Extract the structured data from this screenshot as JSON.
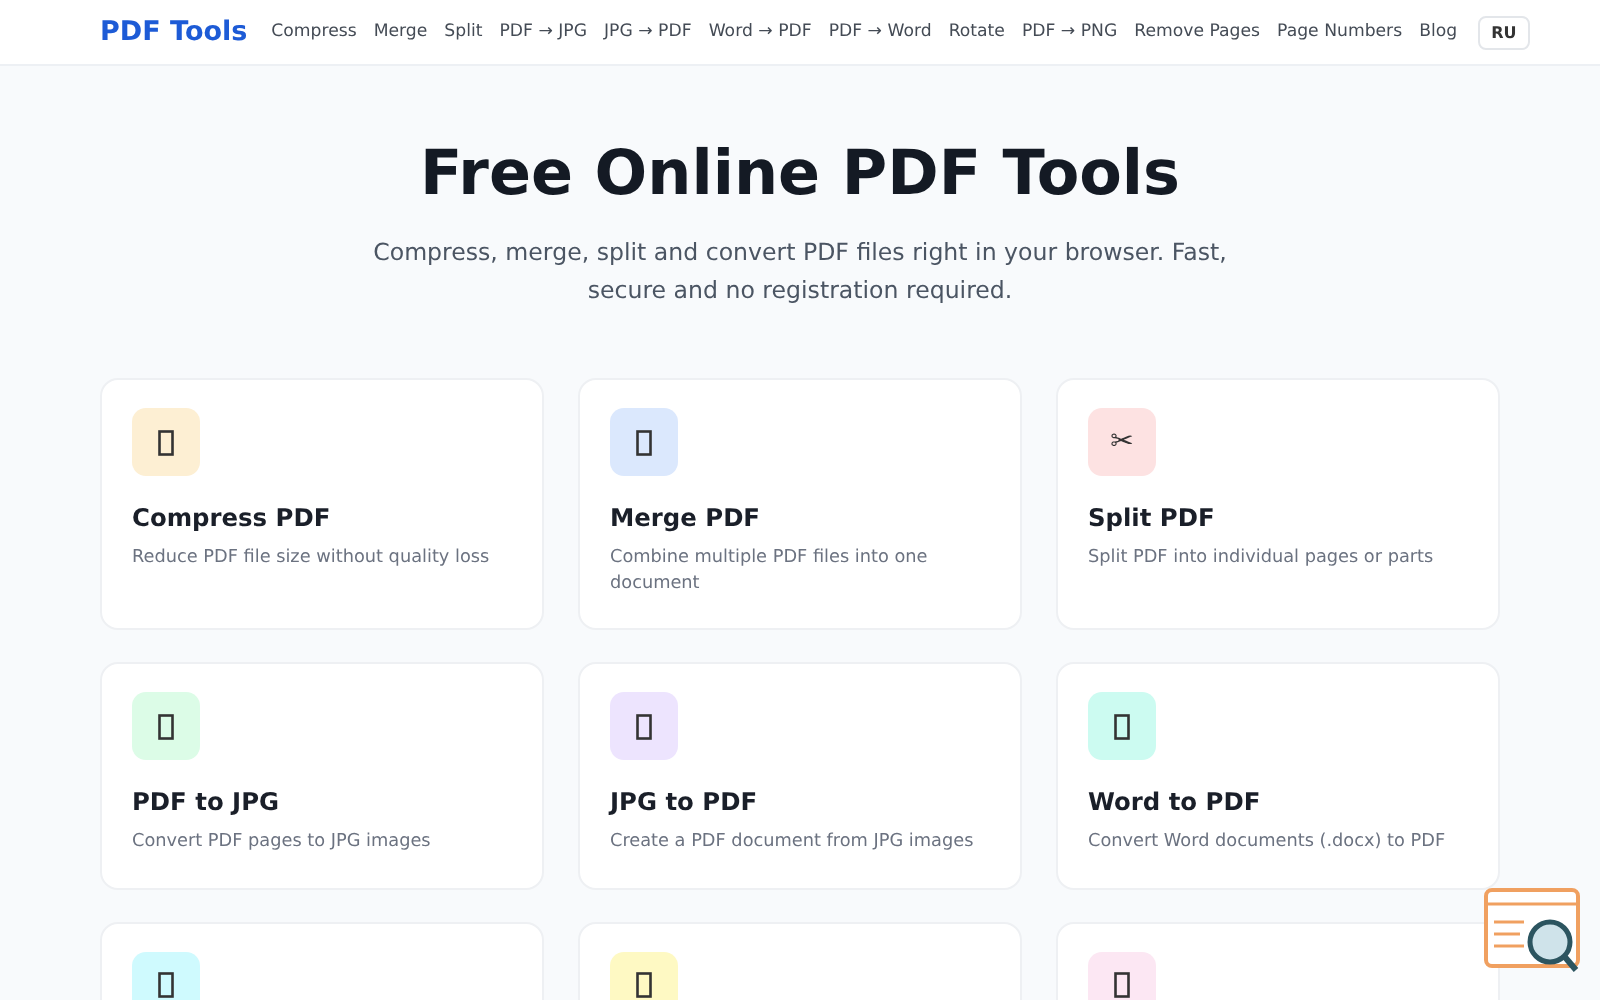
{
  "header": {
    "logo": "PDF Tools",
    "nav": [
      "Compress",
      "Merge",
      "Split",
      "PDF → JPG",
      "JPG → PDF",
      "Word → PDF",
      "PDF → Word",
      "Rotate",
      "PDF → PNG",
      "Remove Pages",
      "Page Numbers",
      "Blog"
    ],
    "language": "RU"
  },
  "hero": {
    "title": "Free Online PDF Tools",
    "subtitle": "Compress, merge, split and convert PDF files right in your browser. Fast, secure and no registration required."
  },
  "tools": [
    {
      "kind": "missing",
      "color": "#fdefd3",
      "title": "Compress PDF",
      "description": "Reduce PDF file size without quality loss"
    },
    {
      "kind": "missing",
      "color": "#dbe8fd",
      "title": "Merge PDF",
      "description": "Combine multiple PDF files into one document"
    },
    {
      "kind": "glyph",
      "glyph": "✂",
      "color": "#fde2e2",
      "title": "Split PDF",
      "description": "Split PDF into individual pages or parts"
    },
    {
      "kind": "missing",
      "color": "#dcfce7",
      "title": "PDF to JPG",
      "description": "Convert PDF pages to JPG images"
    },
    {
      "kind": "missing",
      "color": "#ede4fe",
      "title": "JPG to PDF",
      "description": "Create a PDF document from JPG images"
    },
    {
      "kind": "missing",
      "color": "#ccfbf1",
      "title": "Word to PDF",
      "description": "Convert Word documents (.docx) to PDF"
    },
    {
      "kind": "missing",
      "color": "#cffafe"
    },
    {
      "kind": "missing",
      "color": "#fef9c3"
    },
    {
      "kind": "missing",
      "color": "#fce7f3"
    }
  ]
}
